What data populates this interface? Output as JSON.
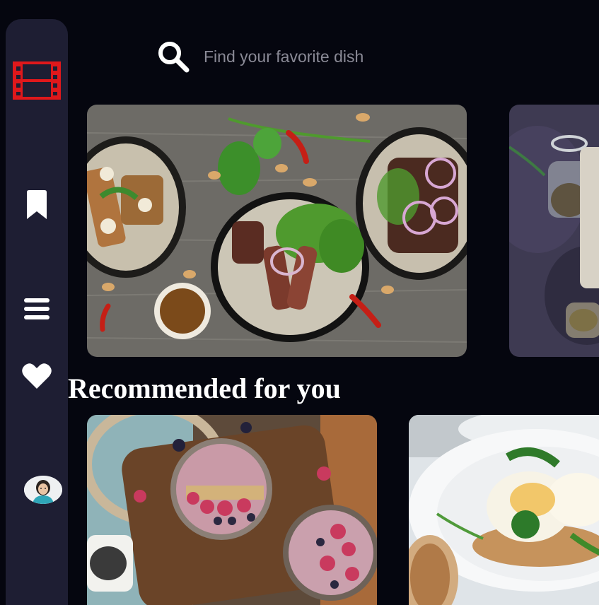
{
  "sidebar": {
    "items": [
      {
        "name": "logo",
        "icon": "film-icon",
        "color": "#e0181b"
      },
      {
        "name": "bookmarks",
        "icon": "bookmark-icon"
      },
      {
        "name": "menu",
        "icon": "menu-icon"
      },
      {
        "name": "favorites",
        "icon": "heart-icon"
      },
      {
        "name": "profile",
        "icon": "avatar"
      }
    ],
    "background": "#1e1e33"
  },
  "search": {
    "placeholder": "Find your favorite dish",
    "value": "",
    "icon": "search-icon"
  },
  "featured": [
    {
      "image": "overhead dishes of grilled steak salad on wooden table"
    },
    {
      "image": "jars of seeds on dark stone surface"
    }
  ],
  "recommended": {
    "title": "Recommended for you",
    "items": [
      {
        "image": "berry smoothie bowls on wooden board"
      },
      {
        "image": "eggs benedict with herbs on white plate"
      }
    ]
  },
  "colors": {
    "background": "#05060f",
    "accent": "#e0181b",
    "text": "#ffffff",
    "placeholder": "#8a8a96"
  }
}
